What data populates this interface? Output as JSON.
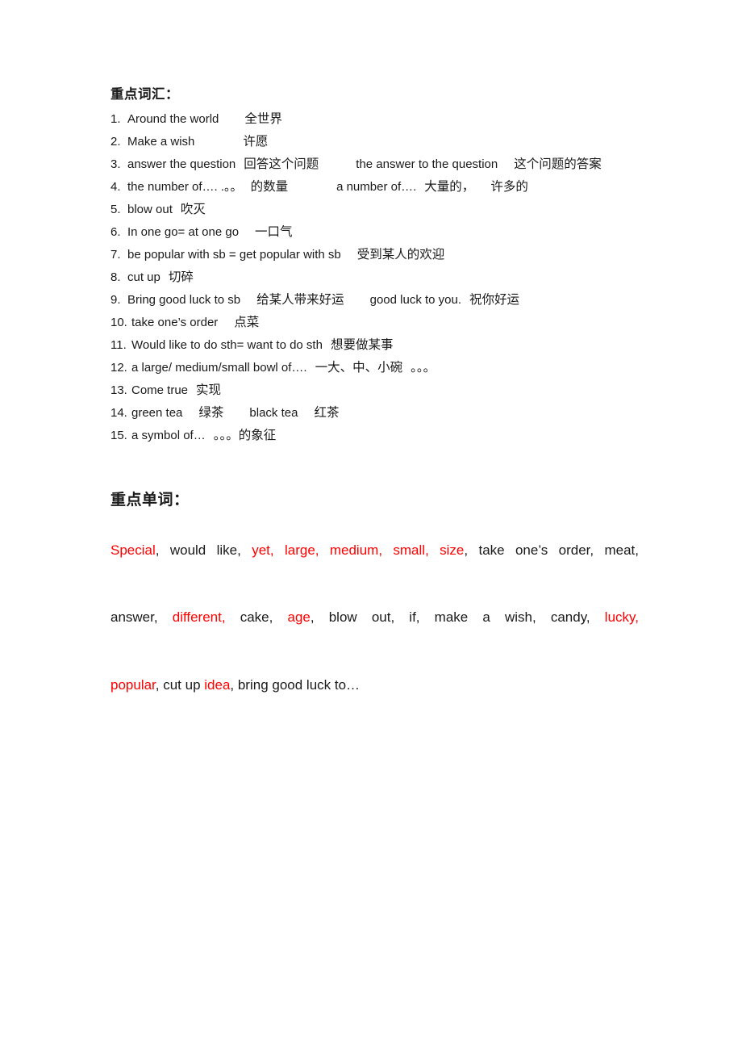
{
  "document": {
    "section1": {
      "heading": "重点词汇：",
      "items": [
        {
          "num": "1.",
          "parts": [
            {
              "text": "Around the world",
              "cls": "en"
            },
            {
              "text": "sp3",
              "cls": "space"
            },
            {
              "text": "全世界",
              "cls": "cn"
            }
          ]
        },
        {
          "num": "2.",
          "parts": [
            {
              "text": "Make a wish",
              "cls": "en"
            },
            {
              "text": "sp5",
              "cls": "space"
            },
            {
              "text": "许愿",
              "cls": "cn"
            }
          ]
        },
        {
          "num": "3.",
          "parts": [
            {
              "text": "answer the question",
              "cls": "en"
            },
            {
              "text": "sp1",
              "cls": "space"
            },
            {
              "text": "回答这个问题",
              "cls": "cn"
            },
            {
              "text": "sp4",
              "cls": "space"
            },
            {
              "text": "the answer to the question",
              "cls": "en"
            },
            {
              "text": "sp2",
              "cls": "space"
            },
            {
              "text": "这个问题的答案",
              "cls": "cn"
            }
          ]
        },
        {
          "num": "4.",
          "parts": [
            {
              "text": "the number of…. .。。",
              "cls": "en"
            },
            {
              "text": "sp1",
              "cls": "space"
            },
            {
              "text": "的数量",
              "cls": "cn"
            },
            {
              "text": "sp5",
              "cls": "space"
            },
            {
              "text": "a number of….",
              "cls": "en"
            },
            {
              "text": "sp1",
              "cls": "space"
            },
            {
              "text": "大量的，",
              "cls": "cn"
            },
            {
              "text": "sp2",
              "cls": "space"
            },
            {
              "text": "许多的",
              "cls": "cn"
            }
          ]
        },
        {
          "num": "5.",
          "parts": [
            {
              "text": "blow out",
              "cls": "en"
            },
            {
              "text": "sp1",
              "cls": "space"
            },
            {
              "text": "吹灭",
              "cls": "cn"
            }
          ]
        },
        {
          "num": "6.",
          "parts": [
            {
              "text": "In one go= at one go",
              "cls": "en"
            },
            {
              "text": "sp2",
              "cls": "space"
            },
            {
              "text": "一口气",
              "cls": "cn"
            }
          ]
        },
        {
          "num": "7.",
          "parts": [
            {
              "text": "be popular with sb = get popular with sb",
              "cls": "en"
            },
            {
              "text": "sp2",
              "cls": "space"
            },
            {
              "text": "受到某人的欢迎",
              "cls": "cn"
            }
          ]
        },
        {
          "num": "8.",
          "parts": [
            {
              "text": "cut up",
              "cls": "en"
            },
            {
              "text": "sp1",
              "cls": "space"
            },
            {
              "text": "切碎",
              "cls": "cn"
            }
          ]
        },
        {
          "num": "9.",
          "parts": [
            {
              "text": "Bring good luck to sb",
              "cls": "en"
            },
            {
              "text": "sp2",
              "cls": "space"
            },
            {
              "text": "给某人带来好运",
              "cls": "cn"
            },
            {
              "text": "sp3",
              "cls": "space"
            },
            {
              "text": "good luck to you.",
              "cls": "en"
            },
            {
              "text": "sp1",
              "cls": "space"
            },
            {
              "text": "祝你好运",
              "cls": "cn"
            }
          ]
        },
        {
          "num": "10.",
          "parts": [
            {
              "text": "take one’s order",
              "cls": "en"
            },
            {
              "text": "sp2",
              "cls": "space"
            },
            {
              "text": "点菜",
              "cls": "cn"
            }
          ]
        },
        {
          "num": "11.",
          "parts": [
            {
              "text": "Would like to do sth= want to do sth",
              "cls": "en"
            },
            {
              "text": "sp1",
              "cls": "space"
            },
            {
              "text": "想要做某事",
              "cls": "cn"
            }
          ]
        },
        {
          "num": "12.",
          "parts": [
            {
              "text": "a large/ medium/small bowl of….",
              "cls": "en"
            },
            {
              "text": "sp1",
              "cls": "space"
            },
            {
              "text": "一大、中、小碗",
              "cls": "cn"
            },
            {
              "text": "sp1",
              "cls": "space"
            },
            {
              "text": "。。。",
              "cls": "cn"
            }
          ]
        },
        {
          "num": "13.",
          "parts": [
            {
              "text": "Come true",
              "cls": "en"
            },
            {
              "text": "sp1",
              "cls": "space"
            },
            {
              "text": "实现",
              "cls": "cn"
            }
          ]
        },
        {
          "num": "14.",
          "parts": [
            {
              "text": "green tea",
              "cls": "en"
            },
            {
              "text": "sp2",
              "cls": "space"
            },
            {
              "text": "绿茶",
              "cls": "cn"
            },
            {
              "text": "sp3",
              "cls": "space"
            },
            {
              "text": "black tea",
              "cls": "en"
            },
            {
              "text": "sp2",
              "cls": "space"
            },
            {
              "text": "红茶",
              "cls": "cn"
            }
          ]
        },
        {
          "num": "15.",
          "parts": [
            {
              "text": "a symbol of…",
              "cls": "en"
            },
            {
              "text": "sp1",
              "cls": "space"
            },
            {
              "text": "。。。的象征",
              "cls": "cn"
            }
          ]
        }
      ]
    },
    "section2": {
      "heading": "重点单词：",
      "lines": [
        {
          "justify": true,
          "segments": [
            {
              "text": "Special",
              "color": "red"
            },
            {
              "text": ", would like, ",
              "color": "black"
            },
            {
              "text": "yet, large, medium, small, size",
              "color": "red"
            },
            {
              "text": ", take one’s order, meat,",
              "color": "black"
            }
          ]
        },
        {
          "justify": true,
          "segments": [
            {
              "text": "answer, ",
              "color": "black"
            },
            {
              "text": "different,",
              "color": "red"
            },
            {
              "text": " cake, ",
              "color": "black"
            },
            {
              "text": "age",
              "color": "red"
            },
            {
              "text": ", blow out, if, make a wish, candy, ",
              "color": "black"
            },
            {
              "text": "lucky,",
              "color": "red"
            }
          ]
        },
        {
          "justify": false,
          "segments": [
            {
              "text": "popular",
              "color": "red"
            },
            {
              "text": ", cut up ",
              "color": "black"
            },
            {
              "text": "idea",
              "color": "red"
            },
            {
              "text": ", bring good luck to…",
              "color": "black"
            }
          ]
        }
      ]
    }
  },
  "colors": {
    "accent_red": "#ff0000",
    "text": "#1a1a1a",
    "background": "#ffffff"
  }
}
